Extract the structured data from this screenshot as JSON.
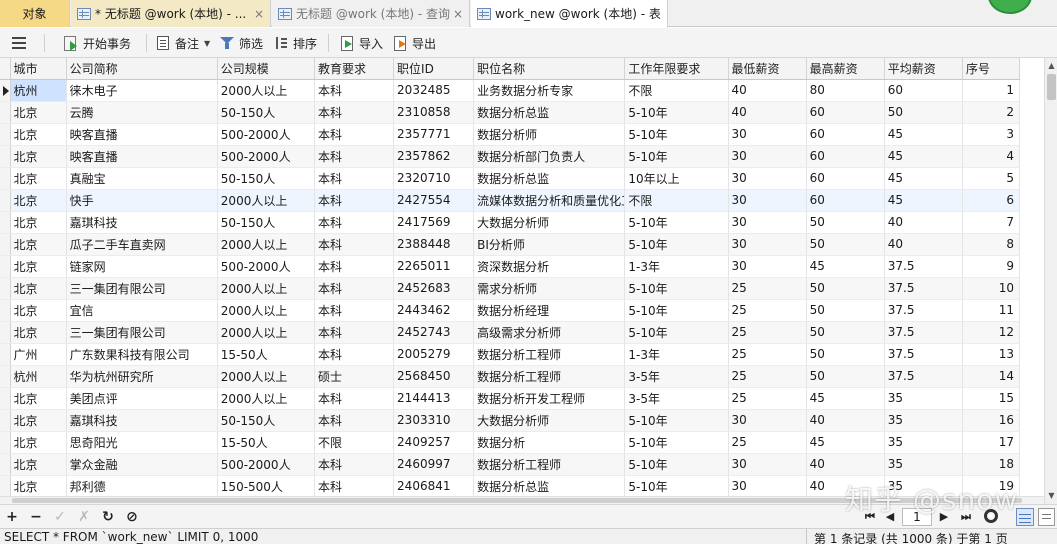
{
  "tabs": [
    {
      "label": "对象"
    },
    {
      "label": "* 无标题 @work (本地) - ...",
      "close": "×"
    },
    {
      "label": "无标题 @work (本地) - 查询",
      "close": "×"
    },
    {
      "label": "work_new @work (本地) - 表"
    }
  ],
  "toolbar": {
    "begin_tx": "开始事务",
    "memo": "备注",
    "filter": "筛选",
    "sort": "排序",
    "import": "导入",
    "export": "导出"
  },
  "columns": [
    "城市",
    "公司简称",
    "公司规模",
    "教育要求",
    "职位ID",
    "职位名称",
    "工作年限要求",
    "最低薪资",
    "最高薪资",
    "平均薪资",
    "序号"
  ],
  "rows": [
    [
      "杭州",
      "徕木电子",
      "2000人以上",
      "本科",
      "2032485",
      "业务数据分析专家",
      "不限",
      "40",
      "80",
      "60",
      "1"
    ],
    [
      "北京",
      "云腾",
      "50-150人",
      "本科",
      "2310858",
      "数据分析总监",
      "5-10年",
      "40",
      "60",
      "50",
      "2"
    ],
    [
      "北京",
      "映客直播",
      "500-2000人",
      "本科",
      "2357771",
      "数据分析师",
      "5-10年",
      "30",
      "60",
      "45",
      "3"
    ],
    [
      "北京",
      "映客直播",
      "500-2000人",
      "本科",
      "2357862",
      "数据分析部门负责人",
      "5-10年",
      "30",
      "60",
      "45",
      "4"
    ],
    [
      "北京",
      "真融宝",
      "50-150人",
      "本科",
      "2320710",
      "数据分析总监",
      "10年以上",
      "30",
      "60",
      "45",
      "5"
    ],
    [
      "北京",
      "快手",
      "2000人以上",
      "本科",
      "2427554",
      "流媒体数据分析和质量优化工程师",
      "不限",
      "30",
      "60",
      "45",
      "6"
    ],
    [
      "北京",
      "嘉琪科技",
      "50-150人",
      "本科",
      "2417569",
      "大数据分析师",
      "5-10年",
      "30",
      "50",
      "40",
      "7"
    ],
    [
      "北京",
      "瓜子二手车直卖网",
      "2000人以上",
      "本科",
      "2388448",
      "BI分析师",
      "5-10年",
      "30",
      "50",
      "40",
      "8"
    ],
    [
      "北京",
      "链家网",
      "500-2000人",
      "本科",
      "2265011",
      "资深数据分析",
      "1-3年",
      "30",
      "45",
      "37.5",
      "9"
    ],
    [
      "北京",
      "三一集团有限公司",
      "2000人以上",
      "本科",
      "2452683",
      "需求分析师",
      "5-10年",
      "25",
      "50",
      "37.5",
      "10"
    ],
    [
      "北京",
      "宜信",
      "2000人以上",
      "本科",
      "2443462",
      "数据分析经理",
      "5-10年",
      "25",
      "50",
      "37.5",
      "11"
    ],
    [
      "北京",
      "三一集团有限公司",
      "2000人以上",
      "本科",
      "2452743",
      "高级需求分析师",
      "5-10年",
      "25",
      "50",
      "37.5",
      "12"
    ],
    [
      "广州",
      "广东数果科技有限公司",
      "15-50人",
      "本科",
      "2005279",
      "数据分析工程师",
      "1-3年",
      "25",
      "50",
      "37.5",
      "13"
    ],
    [
      "杭州",
      "华为杭州研究所",
      "2000人以上",
      "硕士",
      "2568450",
      "数据分析工程师",
      "3-5年",
      "25",
      "50",
      "37.5",
      "14"
    ],
    [
      "北京",
      "美团点评",
      "2000人以上",
      "本科",
      "2144413",
      "数据分析开发工程师",
      "3-5年",
      "25",
      "45",
      "35",
      "15"
    ],
    [
      "北京",
      "嘉琪科技",
      "50-150人",
      "本科",
      "2303310",
      "大数据分析师",
      "5-10年",
      "30",
      "40",
      "35",
      "16"
    ],
    [
      "北京",
      "思奇阳光",
      "15-50人",
      "不限",
      "2409257",
      "数据分析",
      "5-10年",
      "25",
      "45",
      "35",
      "17"
    ],
    [
      "北京",
      "掌众金融",
      "500-2000人",
      "本科",
      "2460997",
      "数据分析工程师",
      "5-10年",
      "30",
      "40",
      "35",
      "18"
    ],
    [
      "北京",
      "邦利德",
      "150-500人",
      "本科",
      "2406841",
      "数据分析总监",
      "5-10年",
      "30",
      "40",
      "35",
      "19"
    ]
  ],
  "nav": {
    "add": "+",
    "delete": "−",
    "apply": "✓",
    "discard": "✗",
    "refresh": "↻",
    "stop": "⊘",
    "first": "⏮",
    "prev": "◀",
    "page": "1",
    "next": "▶",
    "last": "⏭"
  },
  "watermark": "知乎 @snow",
  "status": {
    "sql": "SELECT * FROM `work_new` LIMIT 0, 1000",
    "records": "第 1 条记录 (共 1000 条) 于第 1 页"
  },
  "colors": {
    "active_tab": "#f5d986",
    "selected_cell": "#cfe3ff",
    "highlight_row": "#eef5ff"
  }
}
